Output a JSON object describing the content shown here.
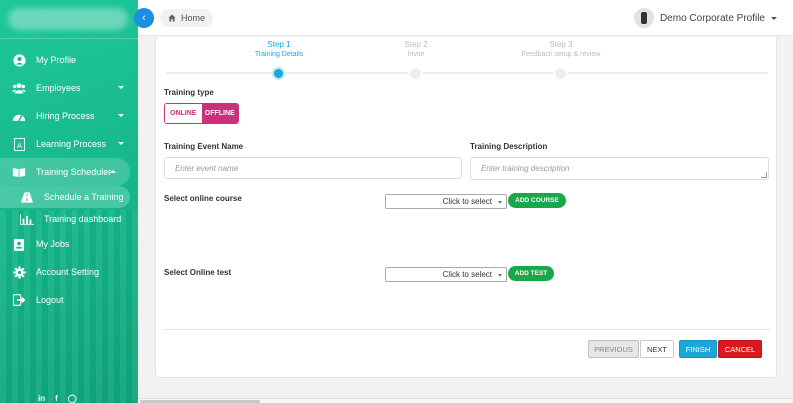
{
  "topbar": {
    "breadcrumb": "Home",
    "profile_name": "Demo Corporate Profile"
  },
  "sidebar": {
    "items": [
      {
        "label": "My Profile",
        "icon": "user-icon"
      },
      {
        "label": "Employees",
        "icon": "users-icon"
      },
      {
        "label": "Hiring Process",
        "icon": "gauge-icon"
      },
      {
        "label": "Learning Process",
        "icon": "book-a-icon"
      },
      {
        "label": "Training Scheduler",
        "icon": "open-book-icon"
      },
      {
        "label": "Schedule a Training",
        "icon": "road-icon"
      },
      {
        "label": "Training dashboard",
        "icon": "bar-chart-icon"
      },
      {
        "label": "My Jobs",
        "icon": "id-badge-icon"
      },
      {
        "label": "Account Setting",
        "icon": "gear-icon"
      },
      {
        "label": "Logout",
        "icon": "logout-icon"
      }
    ],
    "social": [
      "in",
      "f",
      "◯"
    ]
  },
  "steps": [
    {
      "title": "Step 1",
      "subtitle": "Training Details",
      "active": true
    },
    {
      "title": "Step 2",
      "subtitle": "Invite",
      "active": false
    },
    {
      "title": "Step 3",
      "subtitle": "Feedback setup & review",
      "active": false
    }
  ],
  "form": {
    "training_type_label": "Training type",
    "online_label": "ONLINE",
    "offline_label": "OFFLINE",
    "event_name_label": "Training Event Name",
    "event_name_placeholder": "Enter event name",
    "description_label": "Training Description",
    "description_placeholder": "Enter training description",
    "course_label": "Select online course",
    "course_select": "Click to select",
    "add_course": "ADD COURSE",
    "test_label": "Select Online test",
    "test_select": "Click to select",
    "add_test": "ADD TEST"
  },
  "buttons": {
    "previous": "PREVIOUS",
    "next": "NEXT",
    "finish": "FINISH",
    "cancel": "CANCEL"
  },
  "colors": {
    "sidebar": "#17b98c",
    "accent": "#1ba7d8",
    "pink": "#cc2f7c",
    "green": "#1aa64a",
    "cancel": "#d9181f"
  }
}
